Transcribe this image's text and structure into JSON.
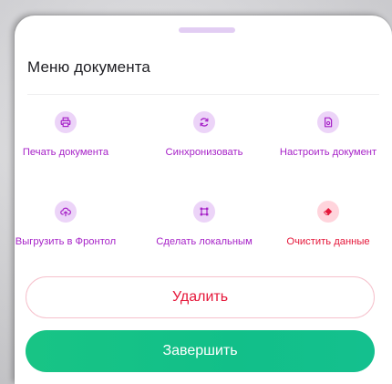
{
  "sheet": {
    "title": "Меню документа"
  },
  "actions": [
    {
      "label": "Печать документа",
      "icon": "printer-icon"
    },
    {
      "label": "Синхронизовать",
      "icon": "sync-icon"
    },
    {
      "label": "Настроить документ",
      "icon": "document-settings-icon"
    },
    {
      "label": "Выгрузить в Фронтол",
      "icon": "cloud-upload-icon"
    },
    {
      "label": "Сделать локальным",
      "icon": "crop-icon"
    },
    {
      "label": "Очистить данные",
      "icon": "eraser-icon"
    }
  ],
  "buttons": {
    "delete_label": "Удалить",
    "finish_label": "Завершить"
  },
  "colors": {
    "accent_purple": "#a723c8",
    "icon_bg_purple": "#ecd4f8",
    "danger_red": "#e5173a",
    "icon_bg_red": "#ffd4dc",
    "finish_green": "#15c387",
    "handle": "#e2cdf3"
  }
}
